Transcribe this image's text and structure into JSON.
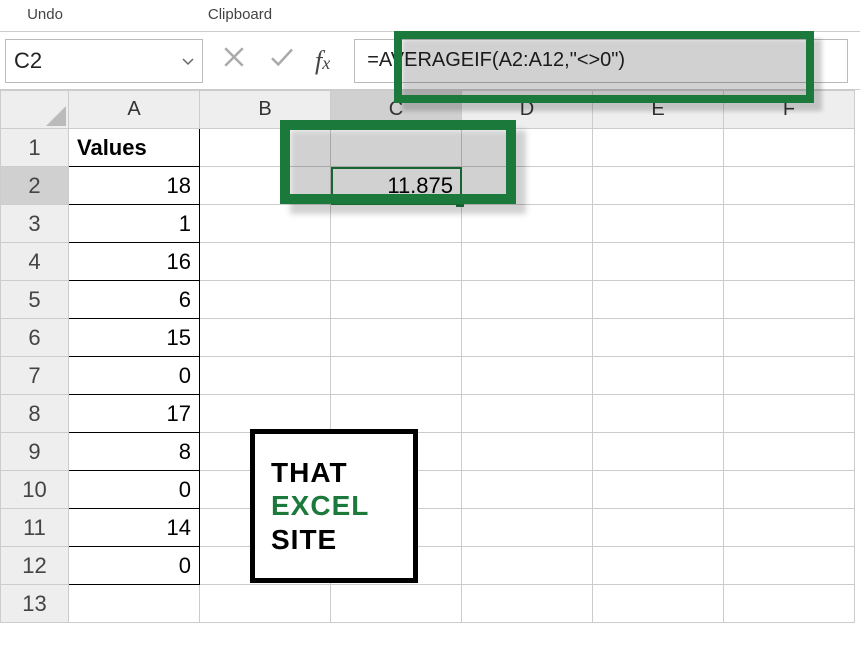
{
  "ribbon": {
    "undo": "Undo",
    "clipboard": "Clipboard"
  },
  "nameBox": {
    "value": "C2"
  },
  "formulaBar": {
    "formula": "=AVERAGEIF(A2:A12,\"<>0\")"
  },
  "columns": [
    "A",
    "B",
    "C",
    "D",
    "E",
    "F"
  ],
  "rowNumbers": [
    "1",
    "2",
    "3",
    "4",
    "5",
    "6",
    "7",
    "8",
    "9",
    "10",
    "11",
    "12",
    "13"
  ],
  "data": {
    "header": "Values",
    "values": [
      "18",
      "1",
      "16",
      "6",
      "15",
      "0",
      "17",
      "8",
      "0",
      "14",
      "0"
    ]
  },
  "activeCell": {
    "address": "C2",
    "display": "11.875"
  },
  "logo": {
    "line1": "THAT",
    "line2": "EXCEL",
    "line3": "SITE"
  },
  "chart_data": {
    "type": "table",
    "title": "Values",
    "categories": [
      "A2",
      "A3",
      "A4",
      "A5",
      "A6",
      "A7",
      "A8",
      "A9",
      "A10",
      "A11",
      "A12"
    ],
    "values": [
      18,
      1,
      16,
      6,
      15,
      0,
      17,
      8,
      0,
      14,
      0
    ],
    "derived": {
      "cell": "C2",
      "formula": "=AVERAGEIF(A2:A12,\"<>0\")",
      "result": 11.875
    }
  }
}
